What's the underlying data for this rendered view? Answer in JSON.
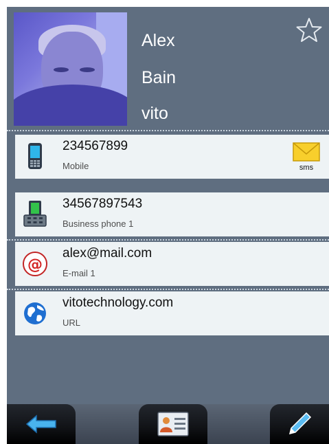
{
  "contact": {
    "first_name": "Alex",
    "last_name": "Bain",
    "company": "vito",
    "favorite": false
  },
  "entries": [
    {
      "value": "234567899",
      "type": "Mobile",
      "icon": "mobile-phone-icon",
      "action_label": "sms",
      "action_icon": "sms-envelope-icon"
    },
    {
      "value": "34567897543",
      "type": "Business phone 1",
      "icon": "desk-phone-icon"
    },
    {
      "value": "alex@mail.com",
      "type": "E-mail 1",
      "icon": "email-at-icon"
    },
    {
      "value": "vitotechnology.com",
      "type": "URL",
      "icon": "globe-icon"
    }
  ],
  "toolbar": {
    "back_icon": "back-arrow-icon",
    "card_icon": "contact-card-icon",
    "edit_icon": "pencil-icon"
  },
  "colors": {
    "background": "#5f6e80",
    "row_background": "#eef3f5",
    "name_text": "#ffffff",
    "sms_envelope": "#f5c518"
  }
}
